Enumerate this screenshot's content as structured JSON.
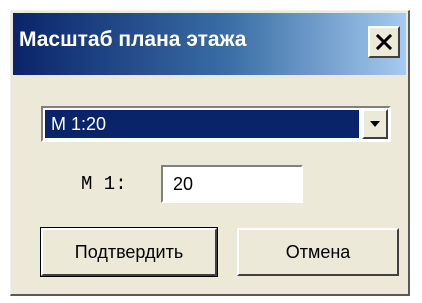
{
  "window": {
    "title": "Масштаб плана этажа",
    "close_icon": "close-icon"
  },
  "scale_select": {
    "selected": "M 1:20"
  },
  "scale_field": {
    "label": "M 1:",
    "value": "20"
  },
  "buttons": {
    "confirm_label": "Подтвердить",
    "cancel_label": "Отмена"
  },
  "colors": {
    "titlebar_start": "#0a246a",
    "titlebar_end": "#a6caf0",
    "dialog_face": "#ece9d8",
    "selection": "#0a246a"
  }
}
